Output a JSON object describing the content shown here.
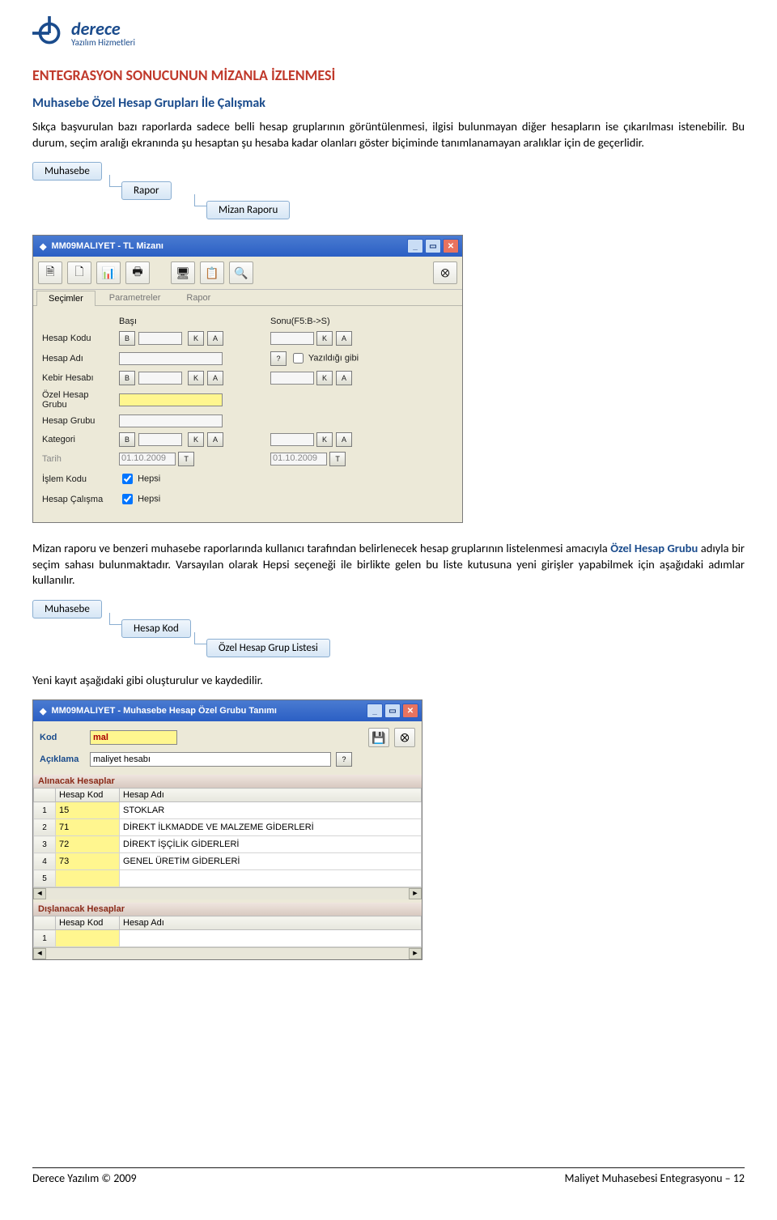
{
  "logo": {
    "brand": "derece",
    "tagline": "Yazılım Hizmetleri"
  },
  "section": {
    "title": "ENTEGRASYON SONUCUNUN MİZANLA İZLENMESİ",
    "subtitle": "Muhasebe Özel Hesap Grupları İle Çalışmak",
    "para1": "Sıkça başvurulan bazı raporlarda sadece belli hesap gruplarının görüntülenmesi, ilgisi bulunmayan diğer hesapların ise çıkarılması istenebilir. Bu durum, seçim aralığı ekranında şu hesaptan şu hesaba kadar olanları göster biçiminde tanımlanamayan aralıklar için de geçerlidir.",
    "para2_pre": "Mizan raporu ve benzeri muhasebe raporlarında kullanıcı tarafından belirlenecek hesap gruplarının listelenmesi amacıyla ",
    "para2_strong": "Özel Hesap Grubu",
    "para2_post": " adıyla bir seçim sahası bulunmaktadır. Varsayılan olarak Hepsi seçeneği ile birlikte gelen bu liste kutusuna yeni girişler yapabilmek için aşağıdaki adımlar kullanılır.",
    "para3": "Yeni kayıt aşağıdaki gibi oluşturulur ve kaydedilir."
  },
  "bc1": {
    "a": "Muhasebe",
    "b": "Rapor",
    "c": "Mizan Raporu"
  },
  "bc2": {
    "a": "Muhasebe",
    "b": "Hesap Kod",
    "c": "Özel Hesap Grup Listesi"
  },
  "win1": {
    "title": "MM09MALIYET - TL Mizanı",
    "tabs": {
      "secimler": "Seçimler",
      "parametreler": "Parametreler",
      "rapor": "Rapor"
    },
    "col_basi": "Başı",
    "col_sonu": "Sonu(F5:B->S)",
    "rows": {
      "hesap_kodu": "Hesap Kodu",
      "hesap_adi": "Hesap Adı",
      "kebir_hesabi": "Kebir Hesabı",
      "ozel_hesap_grubu": "Özel Hesap Grubu",
      "hesap_grubu": "Hesap Grubu",
      "kategori": "Kategori",
      "tarih": "Tarih",
      "islem_kodu": "İşlem Kodu",
      "hesap_calisma": "Hesap Çalışma"
    },
    "tarih1": "01.10.2009",
    "tarih2": "01.10.2009",
    "yazildigi": "Yazıldığı gibi",
    "hepsi": "Hepsi",
    "btnB": "B",
    "btnK": "K",
    "btnA": "A",
    "btnT": "T",
    "btnQ": "?"
  },
  "win2": {
    "title": "MM09MALIYET - Muhasebe Hesap Özel Grubu Tanımı",
    "kod_lbl": "Kod",
    "kod_val": "mal",
    "aciklama_lbl": "Açıklama",
    "aciklama_val": "maliyet hesabı",
    "alinacak": "Alınacak Hesaplar",
    "dislanacak": "Dışlanacak Hesaplar",
    "col_kod": "Hesap Kod",
    "col_adi": "Hesap Adı",
    "rows": [
      {
        "n": "1",
        "kod": "15",
        "adi": "STOKLAR"
      },
      {
        "n": "2",
        "kod": "71",
        "adi": "DİREKT İLKMADDE VE MALZEME GİDERLERİ"
      },
      {
        "n": "3",
        "kod": "72",
        "adi": "DİREKT İŞÇİLİK GİDERLERİ"
      },
      {
        "n": "4",
        "kod": "73",
        "adi": "GENEL ÜRETİM GİDERLERİ"
      },
      {
        "n": "5",
        "kod": "",
        "adi": ""
      }
    ],
    "rowsB": [
      {
        "n": "1",
        "kod": "",
        "adi": ""
      }
    ]
  },
  "footer": {
    "left": "Derece Yazılım © 2009",
    "right": "Maliyet Muhasebesi Entegrasyonu – 12"
  }
}
